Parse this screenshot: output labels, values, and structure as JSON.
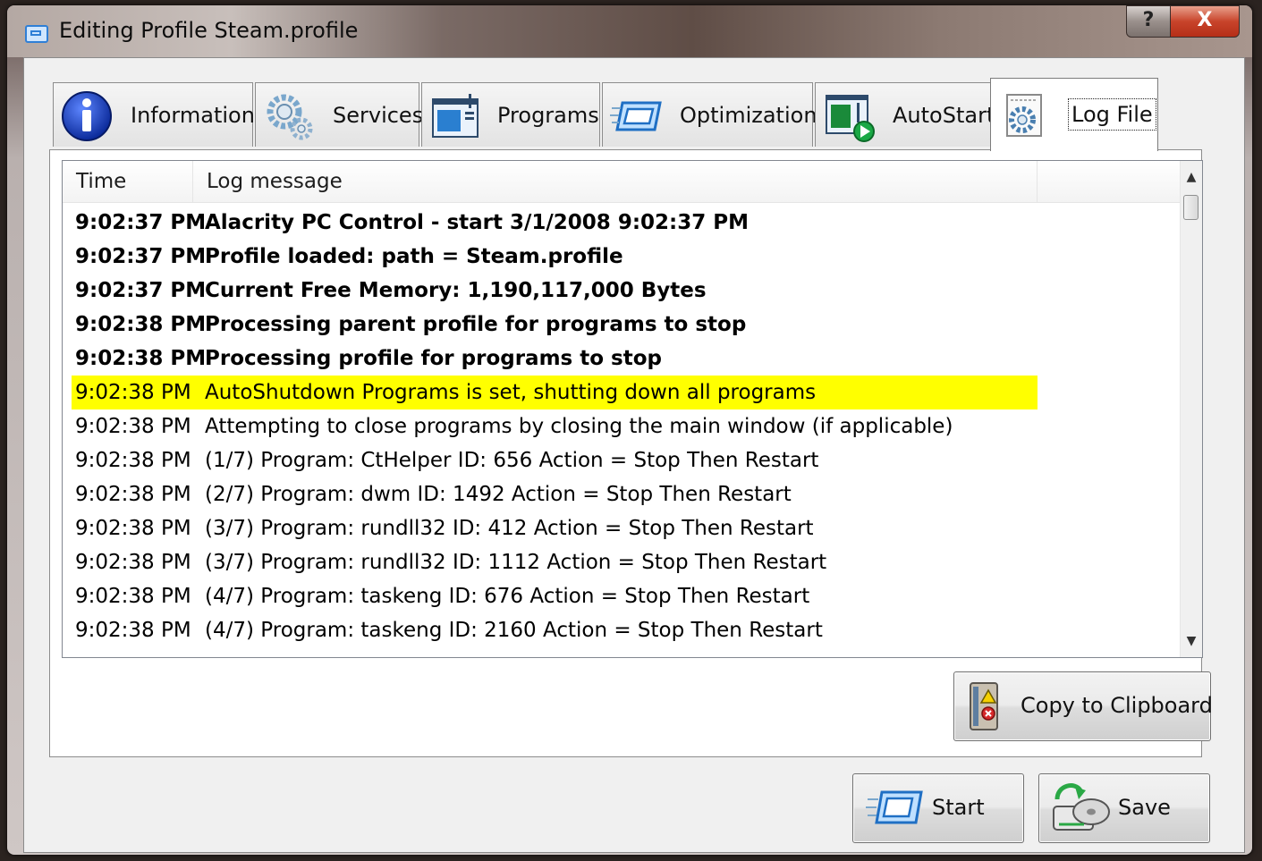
{
  "window": {
    "title": "Editing Profile Steam.profile",
    "help_label": "?",
    "close_label": "X"
  },
  "tabs": [
    {
      "label": "Information",
      "icon": "info-icon"
    },
    {
      "label": "Services",
      "icon": "gears-icon"
    },
    {
      "label": "Programs",
      "icon": "programs-window-icon"
    },
    {
      "label": "Optimization",
      "icon": "optimization-icon"
    },
    {
      "label": "AutoStart",
      "icon": "autostart-play-icon"
    },
    {
      "label": "Log File",
      "icon": "log-file-icon",
      "selected": true
    }
  ],
  "log": {
    "columns": [
      "Time",
      "Log message"
    ],
    "rows": [
      {
        "time": "9:02:37 PM",
        "message": "Alacrity PC Control - start 3/1/2008 9:02:37 PM",
        "bold": true
      },
      {
        "time": "9:02:37 PM",
        "message": "Profile loaded:  path = Steam.profile",
        "bold": true
      },
      {
        "time": "9:02:37 PM",
        "message": "Current Free Memory: 1,190,117,000 Bytes",
        "bold": true
      },
      {
        "time": "9:02:38 PM",
        "message": "Processing parent profile for programs to stop",
        "bold": true
      },
      {
        "time": "9:02:38 PM",
        "message": "Processing profile for programs to stop",
        "bold": true
      },
      {
        "time": "9:02:38 PM",
        "message": "AutoShutdown Programs is set, shutting down all programs",
        "highlight": "#ffff00"
      },
      {
        "time": "9:02:38 PM",
        "message": "Attempting to close programs by closing the main window (if applicable)"
      },
      {
        "time": "9:02:38 PM",
        "message": "(1/7) Program: CtHelper ID: 656 Action = Stop Then Restart"
      },
      {
        "time": "9:02:38 PM",
        "message": "(2/7) Program: dwm ID: 1492 Action = Stop Then Restart"
      },
      {
        "time": "9:02:38 PM",
        "message": "(3/7) Program: rundll32 ID: 412 Action = Stop Then Restart"
      },
      {
        "time": "9:02:38 PM",
        "message": "(3/7) Program: rundll32 ID: 1112 Action = Stop Then Restart"
      },
      {
        "time": "9:02:38 PM",
        "message": "(4/7) Program: taskeng ID: 676 Action = Stop Then Restart"
      },
      {
        "time": "9:02:38 PM",
        "message": "(4/7) Program: taskeng ID: 2160 Action = Stop Then Restart"
      }
    ]
  },
  "buttons": {
    "copy_label": "Copy to Clipboard",
    "start_label": "Start",
    "save_label": "Save"
  }
}
